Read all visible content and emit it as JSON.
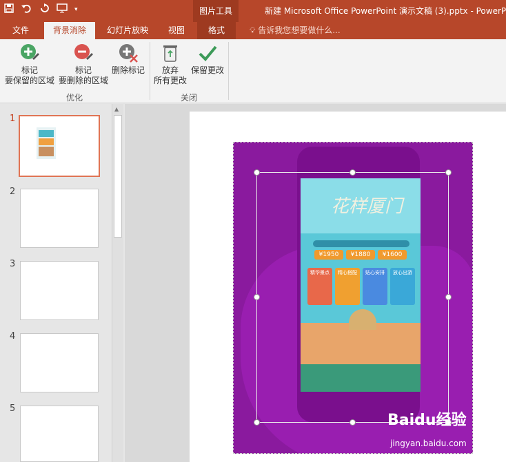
{
  "quick_access": {
    "save_icon": "save-icon",
    "undo_icon": "undo-icon",
    "redo_icon": "redo-icon",
    "present_icon": "present-icon",
    "customize_icon": "chevron-down-icon"
  },
  "titlebar": {
    "context_group": "图片工具",
    "document_title": "新建 Microsoft Office PowerPoint 演示文稿 (3).pptx - PowerPoi"
  },
  "tabs": [
    {
      "label": "文件"
    },
    {
      "label": "背景消除"
    },
    {
      "label": "幻灯片放映"
    },
    {
      "label": "视图"
    },
    {
      "label": "格式"
    }
  ],
  "tellme": {
    "text": "告诉我您想要做什么..."
  },
  "ribbon": {
    "refine": {
      "label": "优化",
      "mark_keep_line1": "标记",
      "mark_keep_line2": "要保留的区域",
      "mark_remove_line1": "标记",
      "mark_remove_line2": "要删除的区域",
      "delete_mark": "删除标记"
    },
    "close": {
      "label": "关闭",
      "discard_line1": "放弃",
      "discard_line2": "所有更改",
      "keep_changes": "保留更改"
    }
  },
  "thumbnails": [
    {
      "number": "1"
    },
    {
      "number": "2"
    },
    {
      "number": "3"
    },
    {
      "number": "4"
    },
    {
      "number": "5"
    }
  ],
  "poster": {
    "title": "花样厦门",
    "prices": [
      "¥1950",
      "¥1880",
      "¥1600"
    ],
    "cards": [
      "精华景点",
      "精心搭配",
      "贴心安排",
      "放心出游"
    ]
  },
  "watermark": {
    "brand": "Baidu经验",
    "url": "jingyan.baidu.com"
  },
  "colors": {
    "accent": "#b7472a",
    "background_removal_magenta": "#8a1a9e",
    "selected_thumb_border": "#e07454"
  }
}
